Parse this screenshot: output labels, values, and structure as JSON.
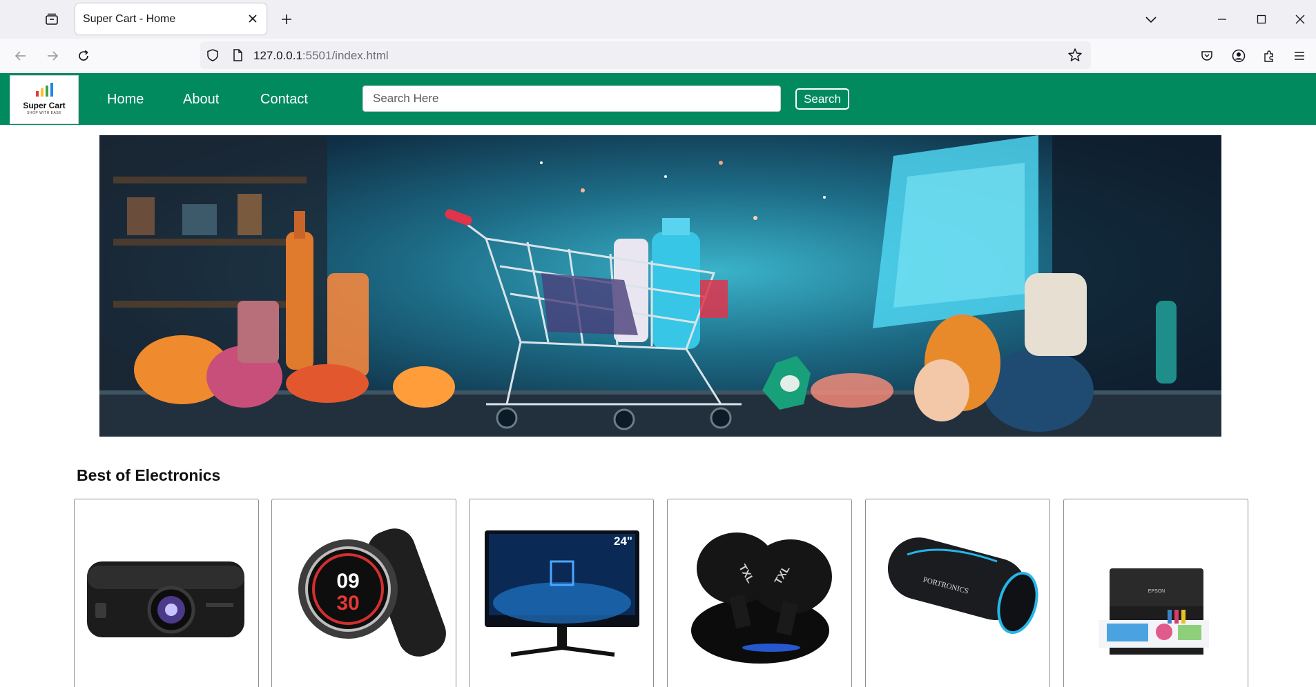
{
  "browser": {
    "tab_title": "Super Cart - Home",
    "url_host": "127.0.0.1",
    "url_rest": ":5501/index.html",
    "icons": [
      "tab-list-icon",
      "close-icon",
      "plus-icon",
      "chevron-down-icon",
      "minimize-icon",
      "maximize-icon",
      "close-window-icon",
      "back-icon",
      "forward-icon",
      "reload-icon",
      "shield-icon",
      "page-icon",
      "star-icon",
      "pocket-icon",
      "account-icon",
      "extensions-icon",
      "menu-icon"
    ]
  },
  "site": {
    "logo_title": "Super Cart",
    "logo_tagline": "SHOP WITH EASE",
    "nav": [
      {
        "label": "Home"
      },
      {
        "label": "About"
      },
      {
        "label": "Contact"
      }
    ],
    "search_placeholder": "Search Here",
    "search_button": "Search",
    "brand_color": "#008a5e"
  },
  "main": {
    "section_title": "Best of Electronics",
    "products": [
      {
        "icon": "projector-icon",
        "label": ""
      },
      {
        "icon": "smartwatch-icon",
        "label": "",
        "watch_hour": "09",
        "watch_minute": "30"
      },
      {
        "icon": "monitor-icon",
        "label": "",
        "screen_size": "24\""
      },
      {
        "icon": "earbuds-icon",
        "label": "",
        "brand": "TXL"
      },
      {
        "icon": "speaker-icon",
        "label": "",
        "brand": "PORTRONICS"
      },
      {
        "icon": "printer-icon",
        "label": "",
        "brand": "EPSON"
      }
    ]
  }
}
